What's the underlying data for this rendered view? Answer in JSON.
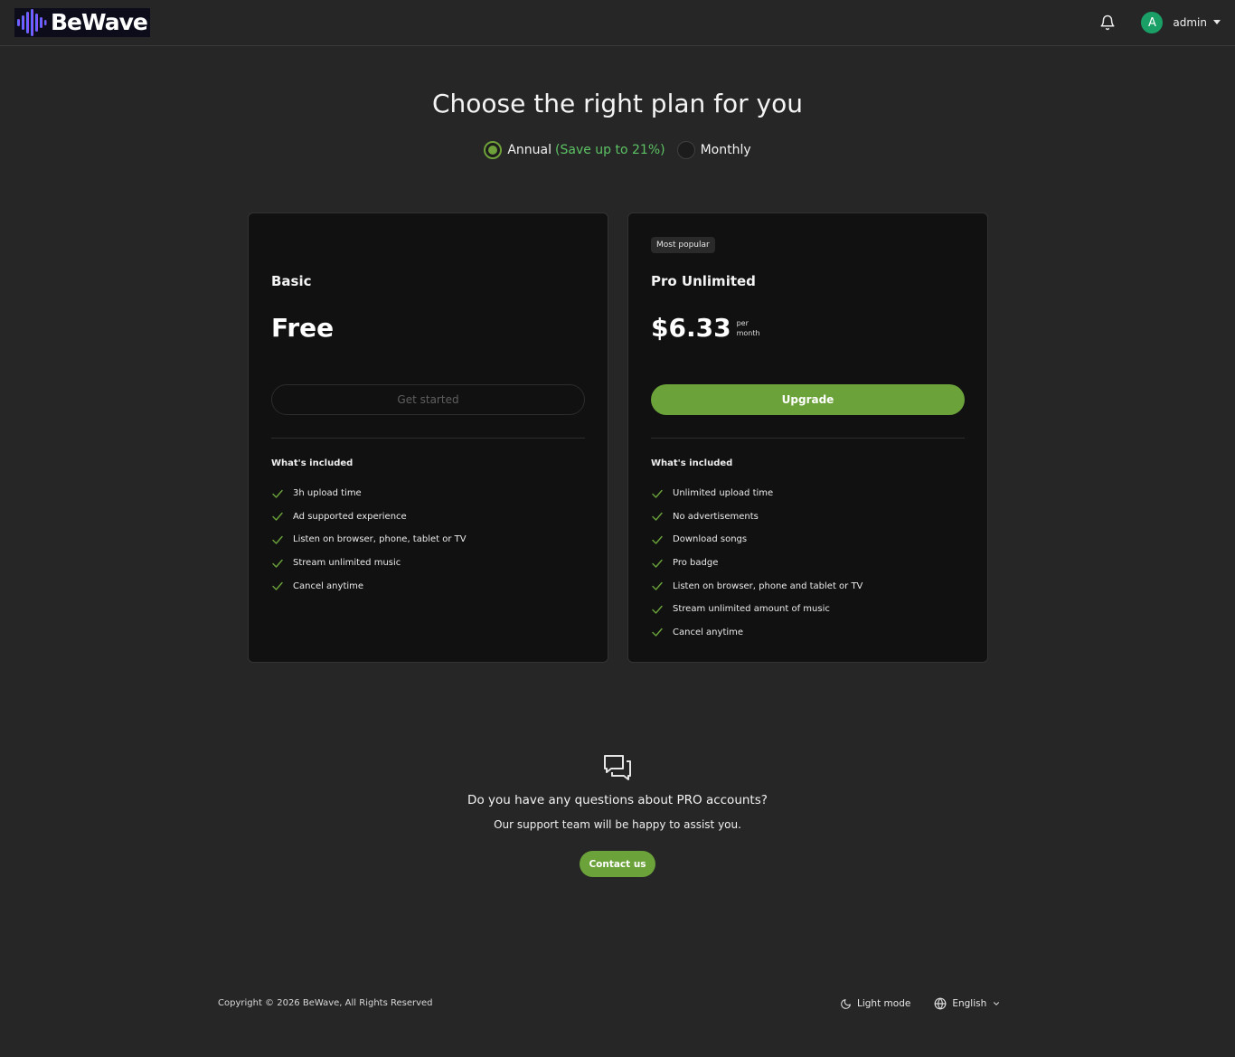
{
  "header": {
    "logo_text": "BeWave",
    "avatar_initial": "A",
    "username": "admin",
    "icons": {
      "notifications": "bell-icon",
      "user_menu": "caret-down-icon"
    }
  },
  "pricing": {
    "title": "Choose the right plan for you",
    "billing": {
      "annual_label": "Annual",
      "annual_note": "(Save up to 21%)",
      "monthly_label": "Monthly",
      "selected": "annual"
    },
    "plans": [
      {
        "name": "Basic",
        "price": "Free",
        "button_label": "Get started",
        "included_title": "What's included",
        "features": [
          "3h upload time",
          "Ad supported experience",
          "Listen on browser, phone, tablet or TV",
          "Stream unlimited music",
          "Cancel anytime"
        ]
      },
      {
        "badge": "Most popular",
        "name": "Pro Unlimited",
        "price": "$6.33",
        "price_unit_line1": "per",
        "price_unit_line2": "month",
        "button_label": "Upgrade",
        "included_title": "What's included",
        "features": [
          "Unlimited upload time",
          "No advertisements",
          "Download songs",
          "Pro badge",
          "Listen on browser, phone and tablet or TV",
          "Stream unlimited amount of music",
          "Cancel anytime"
        ]
      }
    ]
  },
  "support": {
    "question": "Do you have any questions about PRO accounts?",
    "subtitle": "Our support team will be happy to assist you.",
    "button_label": "Contact us"
  },
  "footer": {
    "copyright": "Copyright © 2026 BeWave, All Rights Reserved",
    "theme_label": "Light mode",
    "language_label": "English"
  },
  "colors": {
    "background": "#262626",
    "card": "#111111",
    "accent_green": "#6ba23a",
    "save_green": "#5cc264",
    "avatar": "#1aa067"
  }
}
